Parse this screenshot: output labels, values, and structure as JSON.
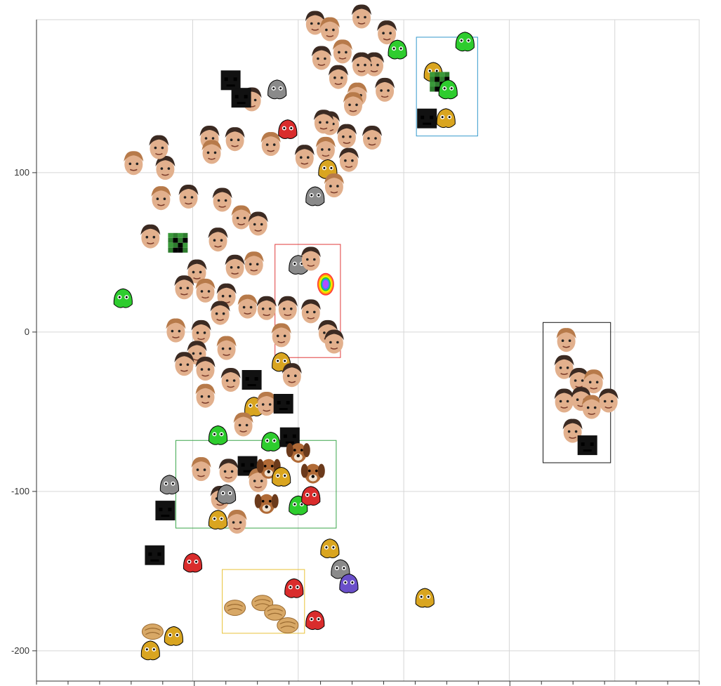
{
  "chart_data": {
    "type": "scatter",
    "title": "",
    "xlabel": "",
    "ylabel": "",
    "xlim": [
      -74,
      240
    ],
    "ylim": [
      -219,
      196
    ],
    "grid": true,
    "y_ticks": [
      100,
      0,
      -100,
      -200
    ],
    "y_tick_labels": [
      "100",
      "0",
      "-100",
      "-200"
    ],
    "x_gridlines": [
      0,
      50,
      100,
      150,
      200
    ],
    "x_minor_tick_count": 21,
    "marker_style": "emote-image",
    "colors": {
      "grid": "#d6d6d6",
      "axis": "#333333",
      "skin": "#e2b08d",
      "hair_dark": "#3b2a22",
      "hair_light": "#b77a4a",
      "green": "#2ecc2e",
      "black": "#111111",
      "red": "#d92c2c",
      "purple": "#6a4fc9",
      "dog": "#b06a36",
      "gold": "#d9a520",
      "gray": "#8a8a8a",
      "food": "#d8a866"
    },
    "cluster_boxes": [
      {
        "name": "cluster-top-right",
        "x": [
          106,
          135
        ],
        "y": [
          123,
          185
        ],
        "color": "#3399cc"
      },
      {
        "name": "cluster-middle",
        "x": [
          39,
          70
        ],
        "y": [
          -16,
          55
        ],
        "color": "#e03b3b"
      },
      {
        "name": "cluster-right",
        "x": [
          166,
          198
        ],
        "y": [
          -82,
          6
        ],
        "color": "#111111"
      },
      {
        "name": "cluster-animals",
        "x": [
          -8,
          68
        ],
        "y": [
          -68,
          -123
        ],
        "color": "#3aa64a"
      },
      {
        "name": "cluster-food",
        "x": [
          14,
          53
        ],
        "y": [
          -149,
          -189
        ],
        "color": "#e8c23a"
      }
    ],
    "points": [
      {
        "x": -28,
        "y": 106,
        "kind": "face"
      },
      {
        "x": -13,
        "y": 103,
        "kind": "face"
      },
      {
        "x": -16,
        "y": 116,
        "kind": "face"
      },
      {
        "x": -15,
        "y": 84,
        "kind": "face"
      },
      {
        "x": -2,
        "y": 85,
        "kind": "face"
      },
      {
        "x": 8,
        "y": 122,
        "kind": "face"
      },
      {
        "x": 9,
        "y": 113,
        "kind": "face"
      },
      {
        "x": 20,
        "y": 121,
        "kind": "face"
      },
      {
        "x": 28,
        "y": 146,
        "kind": "face"
      },
      {
        "x": 37,
        "y": 118,
        "kind": "face"
      },
      {
        "x": 45,
        "y": 127,
        "kind": "red"
      },
      {
        "x": 14,
        "y": 83,
        "kind": "face"
      },
      {
        "x": 23,
        "y": 72,
        "kind": "face"
      },
      {
        "x": 31,
        "y": 68,
        "kind": "face"
      },
      {
        "x": -20,
        "y": 60,
        "kind": "face"
      },
      {
        "x": -7,
        "y": 56,
        "kind": "pixel"
      },
      {
        "x": 12,
        "y": 58,
        "kind": "face"
      },
      {
        "x": 20,
        "y": 41,
        "kind": "face"
      },
      {
        "x": 29,
        "y": 43,
        "kind": "face"
      },
      {
        "x": 2,
        "y": 38,
        "kind": "face"
      },
      {
        "x": -4,
        "y": 28,
        "kind": "face"
      },
      {
        "x": 6,
        "y": 26,
        "kind": "face"
      },
      {
        "x": 16,
        "y": 23,
        "kind": "face"
      },
      {
        "x": 13,
        "y": 12,
        "kind": "face"
      },
      {
        "x": 26,
        "y": 16,
        "kind": "face"
      },
      {
        "x": 35,
        "y": 15,
        "kind": "face"
      },
      {
        "x": -33,
        "y": 21,
        "kind": "green"
      },
      {
        "x": -8,
        "y": 1,
        "kind": "face"
      },
      {
        "x": 4,
        "y": 0,
        "kind": "face"
      },
      {
        "x": 2,
        "y": -13,
        "kind": "face"
      },
      {
        "x": 16,
        "y": -10,
        "kind": "face"
      },
      {
        "x": -4,
        "y": -20,
        "kind": "face"
      },
      {
        "x": 6,
        "y": -23,
        "kind": "face"
      },
      {
        "x": 6,
        "y": -40,
        "kind": "face"
      },
      {
        "x": 18,
        "y": -30,
        "kind": "face"
      },
      {
        "x": 28,
        "y": -30,
        "kind": "black"
      },
      {
        "x": 42,
        "y": -19,
        "kind": "gold"
      },
      {
        "x": 47,
        "y": -27,
        "kind": "face"
      },
      {
        "x": 29,
        "y": -47,
        "kind": "gold"
      },
      {
        "x": 35,
        "y": -45,
        "kind": "face"
      },
      {
        "x": 43,
        "y": -45,
        "kind": "black"
      },
      {
        "x": 12,
        "y": -65,
        "kind": "green"
      },
      {
        "x": 24,
        "y": -58,
        "kind": "face"
      },
      {
        "x": 37,
        "y": -69,
        "kind": "green"
      },
      {
        "x": 46,
        "y": -66,
        "kind": "black"
      },
      {
        "x": 4,
        "y": -86,
        "kind": "face"
      },
      {
        "x": 17,
        "y": -87,
        "kind": "face"
      },
      {
        "x": 26,
        "y": -84,
        "kind": "black"
      },
      {
        "x": 31,
        "y": -93,
        "kind": "face"
      },
      {
        "x": 13,
        "y": -104,
        "kind": "face"
      },
      {
        "x": 18,
        "y": 158,
        "kind": "black"
      },
      {
        "x": 23,
        "y": 147,
        "kind": "black"
      },
      {
        "x": 40,
        "y": 152,
        "kind": "gray"
      },
      {
        "x": 58,
        "y": 194,
        "kind": "face"
      },
      {
        "x": 65,
        "y": 190,
        "kind": "face"
      },
      {
        "x": 80,
        "y": 198,
        "kind": "face"
      },
      {
        "x": 92,
        "y": 188,
        "kind": "face"
      },
      {
        "x": 97,
        "y": 177,
        "kind": "green"
      },
      {
        "x": 86,
        "y": 168,
        "kind": "face"
      },
      {
        "x": 80,
        "y": 168,
        "kind": "face"
      },
      {
        "x": 71,
        "y": 176,
        "kind": "face"
      },
      {
        "x": 61,
        "y": 172,
        "kind": "face"
      },
      {
        "x": 69,
        "y": 160,
        "kind": "face"
      },
      {
        "x": 78,
        "y": 149,
        "kind": "face"
      },
      {
        "x": 91,
        "y": 152,
        "kind": "face"
      },
      {
        "x": 65,
        "y": 131,
        "kind": "face"
      },
      {
        "x": 76,
        "y": 143,
        "kind": "face"
      },
      {
        "x": 85,
        "y": 122,
        "kind": "face"
      },
      {
        "x": 62,
        "y": 132,
        "kind": "face"
      },
      {
        "x": 63,
        "y": 115,
        "kind": "face"
      },
      {
        "x": 73,
        "y": 123,
        "kind": "face"
      },
      {
        "x": 53,
        "y": 110,
        "kind": "face"
      },
      {
        "x": 64,
        "y": 102,
        "kind": "gold"
      },
      {
        "x": 74,
        "y": 108,
        "kind": "face"
      },
      {
        "x": 58,
        "y": 85,
        "kind": "gray"
      },
      {
        "x": 67,
        "y": 92,
        "kind": "face"
      },
      {
        "x": 129,
        "y": 182,
        "kind": "green"
      },
      {
        "x": 114,
        "y": 163,
        "kind": "gold"
      },
      {
        "x": 117,
        "y": 157,
        "kind": "pixel"
      },
      {
        "x": 121,
        "y": 152,
        "kind": "green"
      },
      {
        "x": 111,
        "y": 134,
        "kind": "black"
      },
      {
        "x": 120,
        "y": 134,
        "kind": "gold"
      },
      {
        "x": 50,
        "y": 42,
        "kind": "gray"
      },
      {
        "x": 56,
        "y": 46,
        "kind": "face"
      },
      {
        "x": 63,
        "y": 30,
        "kind": "rainbow"
      },
      {
        "x": 45,
        "y": 15,
        "kind": "face"
      },
      {
        "x": 56,
        "y": 13,
        "kind": "face"
      },
      {
        "x": 42,
        "y": -2,
        "kind": "face"
      },
      {
        "x": 64,
        "y": 0,
        "kind": "face"
      },
      {
        "x": 67,
        "y": -6,
        "kind": "face"
      },
      {
        "x": 177,
        "y": -5,
        "kind": "face"
      },
      {
        "x": 176,
        "y": -22,
        "kind": "face"
      },
      {
        "x": 183,
        "y": -30,
        "kind": "face"
      },
      {
        "x": 190,
        "y": -31,
        "kind": "face"
      },
      {
        "x": 176,
        "y": -43,
        "kind": "face"
      },
      {
        "x": 184,
        "y": -42,
        "kind": "face"
      },
      {
        "x": 189,
        "y": -47,
        "kind": "face"
      },
      {
        "x": 197,
        "y": -43,
        "kind": "face"
      },
      {
        "x": 180,
        "y": -62,
        "kind": "face"
      },
      {
        "x": 187,
        "y": -71,
        "kind": "black"
      },
      {
        "x": 50,
        "y": -75,
        "kind": "dog"
      },
      {
        "x": 36,
        "y": -85,
        "kind": "dog"
      },
      {
        "x": 42,
        "y": -91,
        "kind": "gold"
      },
      {
        "x": 57,
        "y": -88,
        "kind": "dog"
      },
      {
        "x": -11,
        "y": -96,
        "kind": "gray"
      },
      {
        "x": 16,
        "y": -102,
        "kind": "gray"
      },
      {
        "x": 35,
        "y": -107,
        "kind": "dog"
      },
      {
        "x": 50,
        "y": -109,
        "kind": "green"
      },
      {
        "x": 56,
        "y": -103,
        "kind": "red"
      },
      {
        "x": -13,
        "y": -112,
        "kind": "black"
      },
      {
        "x": 12,
        "y": -118,
        "kind": "gold"
      },
      {
        "x": 21,
        "y": -119,
        "kind": "face"
      },
      {
        "x": -18,
        "y": -140,
        "kind": "black"
      },
      {
        "x": 0,
        "y": -145,
        "kind": "red"
      },
      {
        "x": 65,
        "y": -136,
        "kind": "gold"
      },
      {
        "x": 70,
        "y": -149,
        "kind": "gray"
      },
      {
        "x": 74,
        "y": -158,
        "kind": "purple"
      },
      {
        "x": 110,
        "y": -167,
        "kind": "gold"
      },
      {
        "x": 20,
        "y": -173,
        "kind": "food"
      },
      {
        "x": 33,
        "y": -170,
        "kind": "food"
      },
      {
        "x": 39,
        "y": -176,
        "kind": "food"
      },
      {
        "x": 45,
        "y": -184,
        "kind": "food"
      },
      {
        "x": 48,
        "y": -161,
        "kind": "red"
      },
      {
        "x": 58,
        "y": -181,
        "kind": "red"
      },
      {
        "x": -19,
        "y": -188,
        "kind": "food"
      },
      {
        "x": -9,
        "y": -191,
        "kind": "gold"
      },
      {
        "x": -20,
        "y": -200,
        "kind": "gold"
      }
    ]
  }
}
